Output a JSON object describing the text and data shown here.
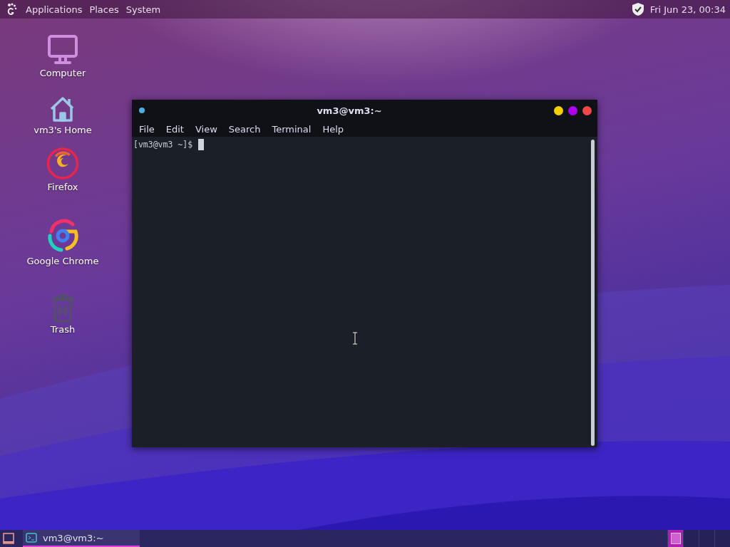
{
  "top_panel": {
    "menus": [
      "Applications",
      "Places",
      "System"
    ],
    "clock": "Fri Jun 23, 00:34"
  },
  "desktop_icons": [
    {
      "kind": "computer",
      "label": "Computer"
    },
    {
      "kind": "home",
      "label": "vm3's Home"
    },
    {
      "kind": "firefox",
      "label": "Firefox"
    },
    {
      "kind": "chrome",
      "label": "Google Chrome"
    },
    {
      "kind": "trash",
      "label": "Trash"
    }
  ],
  "terminal": {
    "title": "vm3@vm3:~",
    "menu": [
      "File",
      "Edit",
      "View",
      "Search",
      "Terminal",
      "Help"
    ],
    "prompt": "[vm3@vm3 ~]$"
  },
  "taskbar": {
    "tasks": [
      {
        "label": "vm3@vm3:~",
        "selected": true
      }
    ],
    "workspaces": [
      {
        "selected": true
      },
      {
        "selected": false
      },
      {
        "selected": false
      },
      {
        "selected": false
      }
    ]
  }
}
